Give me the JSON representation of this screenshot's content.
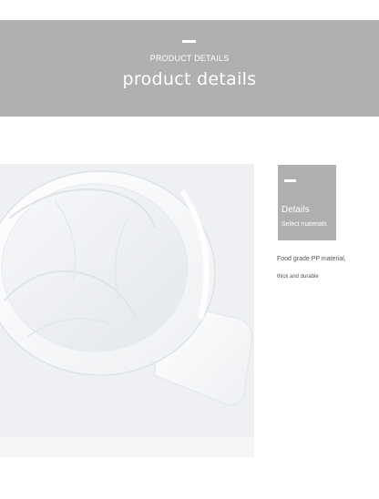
{
  "header": {
    "subtitle": "PRODUCT DETAILS",
    "title": "product details"
  },
  "product_image": {
    "icon": "strainer-product-photo",
    "description_color": "#ffffff"
  },
  "details_card": {
    "title": "Details",
    "subtitle": "Select materials"
  },
  "description": {
    "line1": "Food grade PP material,",
    "line2": "thick and durable"
  },
  "colors": {
    "banner": "#b0b0b0",
    "card": "#afafaf",
    "text": "#555555"
  }
}
